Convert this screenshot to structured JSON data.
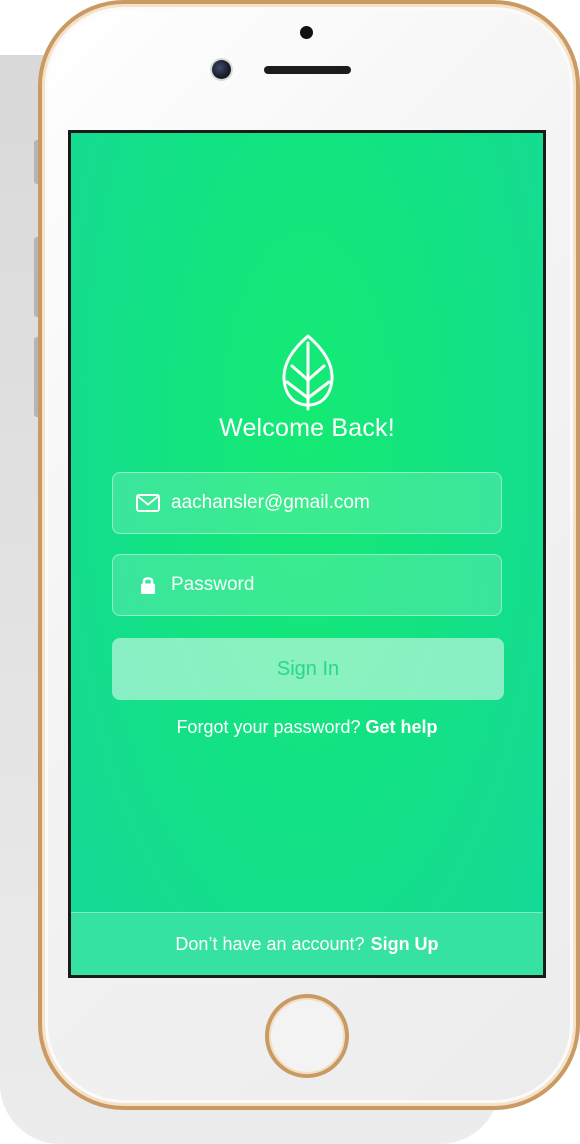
{
  "app": {
    "welcome": "Welcome Back!",
    "email": {
      "value": "aachansler@gmail.com",
      "icon": "envelope-icon"
    },
    "password": {
      "placeholder": "Password",
      "icon": "lock-icon"
    },
    "signin_label": "Sign In",
    "forgot_text": "Forgot your password?",
    "forgot_link": "Get help",
    "signup_text": "Don’t have an account?",
    "signup_link": "Sign Up",
    "logo_icon": "leaf-icon"
  },
  "colors": {
    "background_green": "#13e283",
    "accent_green": "#27d78a",
    "footer_green": "#36e2a2",
    "frame_gold": "#c99a63"
  }
}
